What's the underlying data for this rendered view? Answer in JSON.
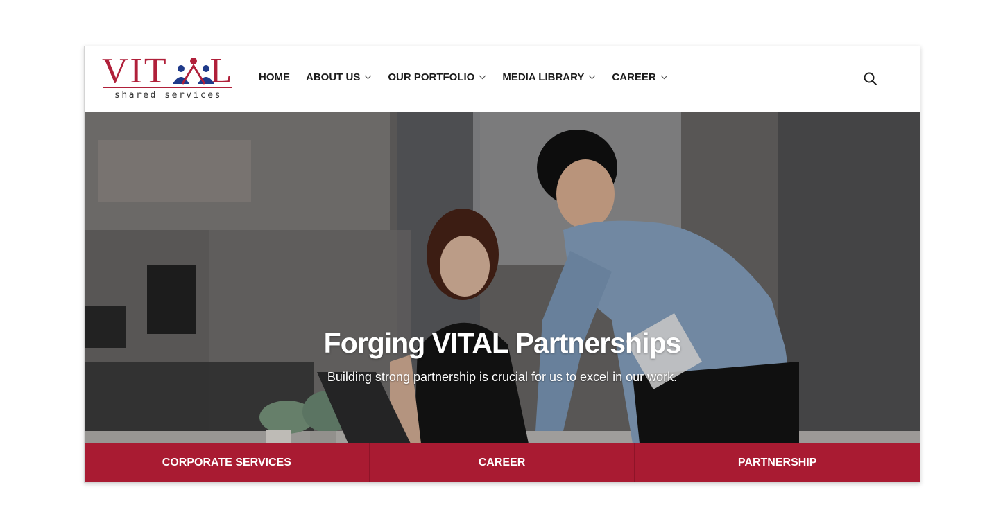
{
  "logo": {
    "word_left": "VIT",
    "word_right": "L",
    "subtitle": "shared services",
    "brand_color": "#b0203a",
    "people_color": "#1f3a8a"
  },
  "nav": {
    "items": [
      {
        "label": "HOME",
        "has_dropdown": false
      },
      {
        "label": "ABOUT US",
        "has_dropdown": true
      },
      {
        "label": "OUR PORTFOLIO",
        "has_dropdown": true
      },
      {
        "label": "MEDIA LIBRARY",
        "has_dropdown": true
      },
      {
        "label": "CAREER",
        "has_dropdown": true
      }
    ],
    "search_icon": "search-icon"
  },
  "hero": {
    "title": "Forging VITAL Partnerships",
    "subtitle": "Building strong partnership is crucial for us to excel in our work."
  },
  "tabs": [
    {
      "label": "CORPORATE SERVICES"
    },
    {
      "label": "CAREER"
    },
    {
      "label": "PARTNERSHIP"
    }
  ],
  "colors": {
    "accent": "#a91b32",
    "nav_text": "#1c1c1c"
  }
}
